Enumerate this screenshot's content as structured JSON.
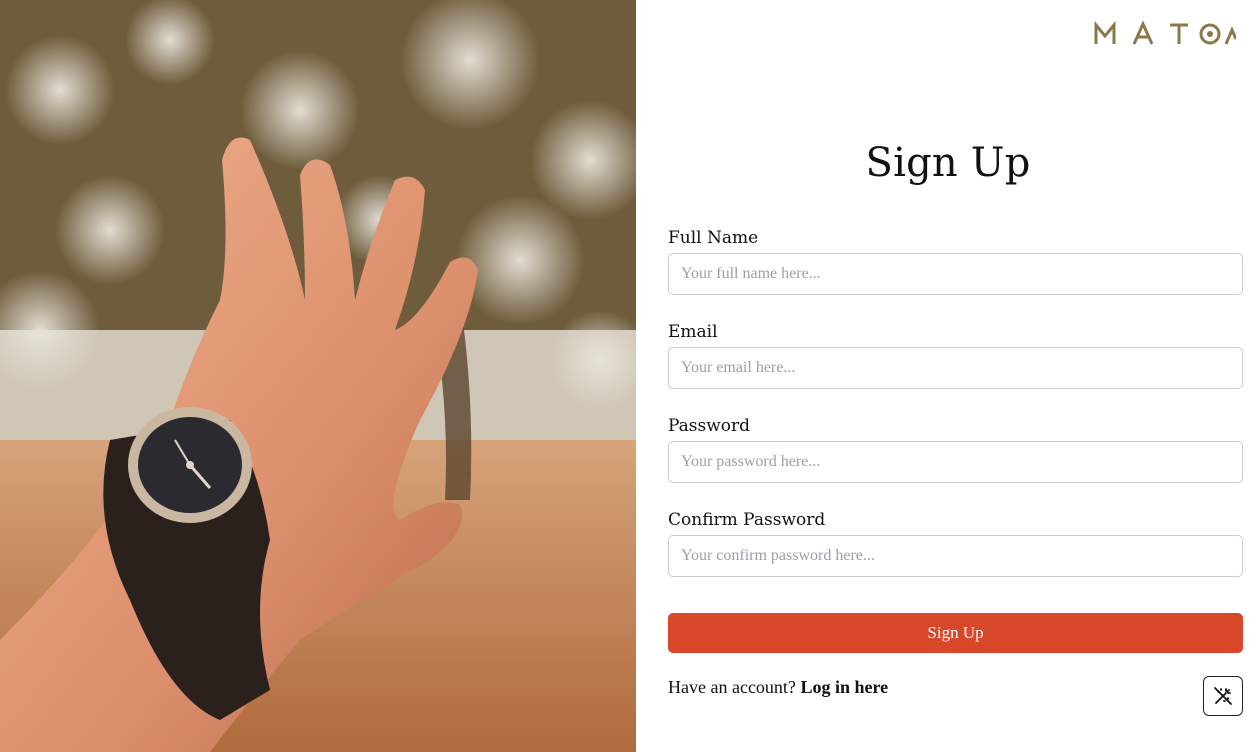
{
  "brand": {
    "logo_text": "MATOA",
    "logo_color": "#8a7a4a"
  },
  "hero": {
    "image": "hand-with-wooden-watch-photo"
  },
  "form": {
    "title": "Sign Up",
    "fields": [
      {
        "label": "Full Name",
        "placeholder": "Your full name here...",
        "value": ""
      },
      {
        "label": "Email",
        "placeholder": "Your email here...",
        "value": ""
      },
      {
        "label": "Password",
        "placeholder": "Your password here...",
        "value": ""
      },
      {
        "label": "Confirm Password",
        "placeholder": "Your confirm password here...",
        "value": ""
      }
    ],
    "submit_label": "Sign Up",
    "submit_color": "#d9472b",
    "login_prompt": "Have an account?",
    "login_link": "Log in here"
  },
  "floating_button": {
    "icon": "magic-wand-off-icon"
  }
}
